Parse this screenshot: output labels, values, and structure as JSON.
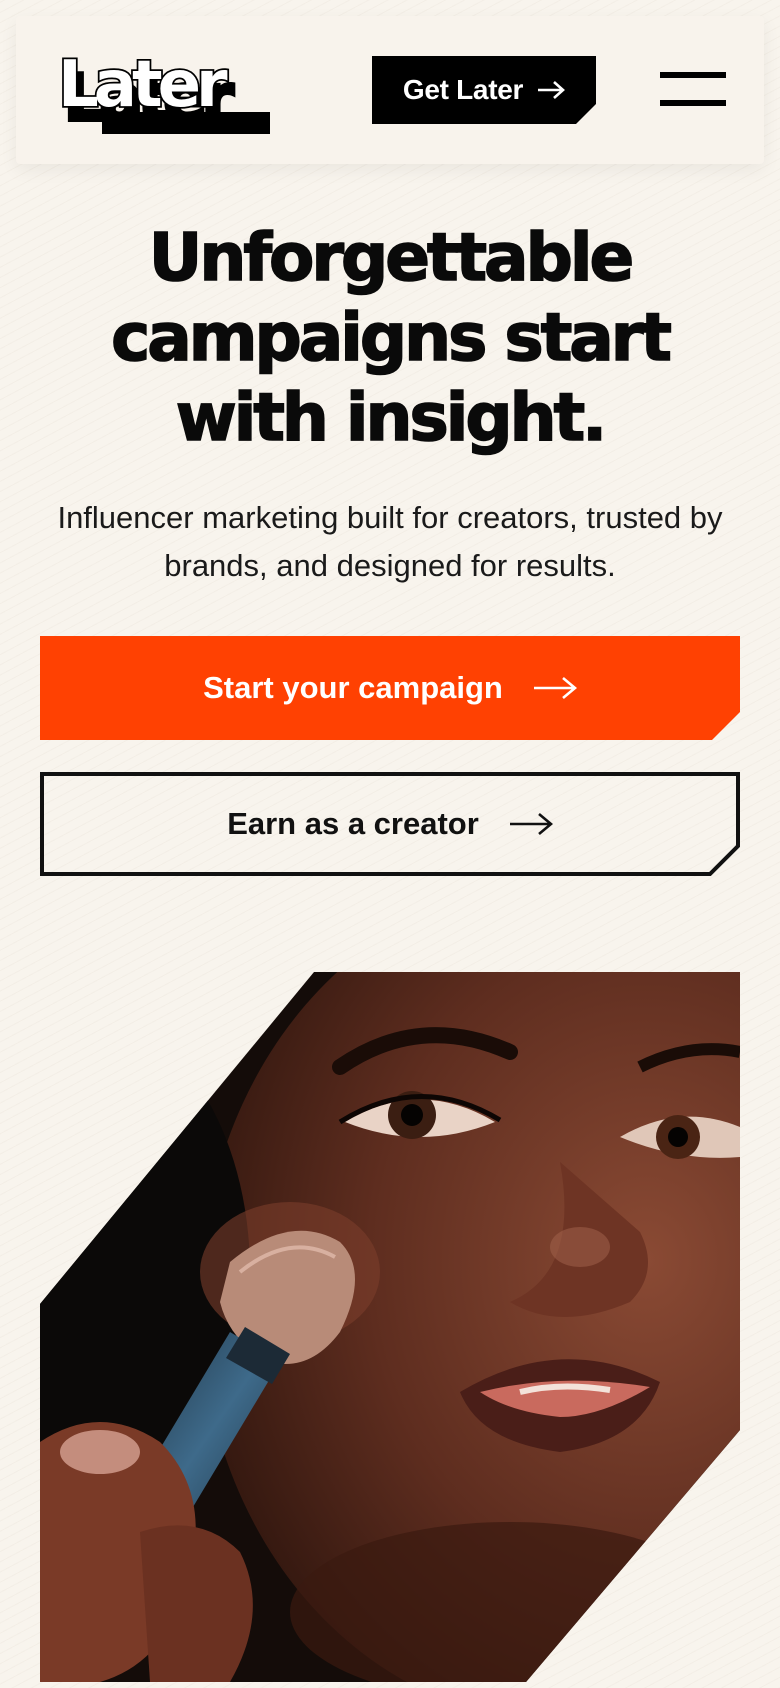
{
  "header": {
    "logo_text": "Later",
    "cta_label": "Get Later",
    "icons": {
      "cta_arrow": "arrow-right-icon",
      "menu": "hamburger-menu-icon"
    }
  },
  "hero": {
    "title_line1": "Unforgettable",
    "title_line2": "campaigns start",
    "title_line3": "with insight.",
    "subtitle": "Influencer marketing built for creators, trusted by brands, and designed for results.",
    "primary_button": "Start your campaign",
    "secondary_button": "Earn as a creator",
    "image_alt": "Person applying makeup with a brush"
  },
  "colors": {
    "background": "#f8f4ed",
    "accent": "#ff4102",
    "ink": "#000000"
  }
}
